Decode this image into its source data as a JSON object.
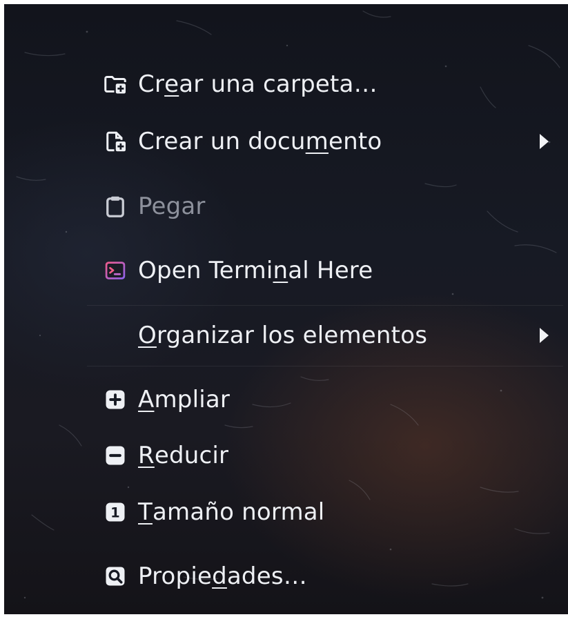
{
  "menu": {
    "items": [
      {
        "before": "Cr",
        "mnemonic": "e",
        "after": "ar una carpeta…",
        "icon": "folder-new-icon",
        "disabled": false,
        "submenu": false
      },
      {
        "before": "Crear un docu",
        "mnemonic": "m",
        "after": "ento",
        "icon": "document-new-icon",
        "disabled": false,
        "submenu": true
      },
      {
        "before": "Pegar",
        "mnemonic": "",
        "after": "",
        "icon": "clipboard-paste-icon",
        "disabled": true,
        "submenu": false
      },
      {
        "before": "Open Termi",
        "mnemonic": "n",
        "after": "al Here",
        "icon": "terminal-icon",
        "disabled": false,
        "submenu": false
      },
      {
        "before": "",
        "mnemonic": "O",
        "after": "rganizar los elementos",
        "icon": "",
        "disabled": false,
        "submenu": true
      },
      {
        "before": "",
        "mnemonic": "A",
        "after": "mpliar",
        "icon": "zoom-in-icon",
        "disabled": false,
        "submenu": false
      },
      {
        "before": "",
        "mnemonic": "R",
        "after": "educir",
        "icon": "zoom-out-icon",
        "disabled": false,
        "submenu": false
      },
      {
        "before": "",
        "mnemonic": "T",
        "after": "amaño normal",
        "icon": "zoom-original-icon",
        "disabled": false,
        "submenu": false
      },
      {
        "before": "Propie",
        "mnemonic": "d",
        "after": "ades…",
        "icon": "document-properties-icon",
        "disabled": false,
        "submenu": false
      }
    ]
  },
  "icons": {
    "zoom_original_digit": "1"
  },
  "colors": {
    "text": "#eef0f4",
    "disabled_text": "#8d919c",
    "terminal_gradient_start": "#f25c8a",
    "terminal_gradient_end": "#8a62f0"
  }
}
